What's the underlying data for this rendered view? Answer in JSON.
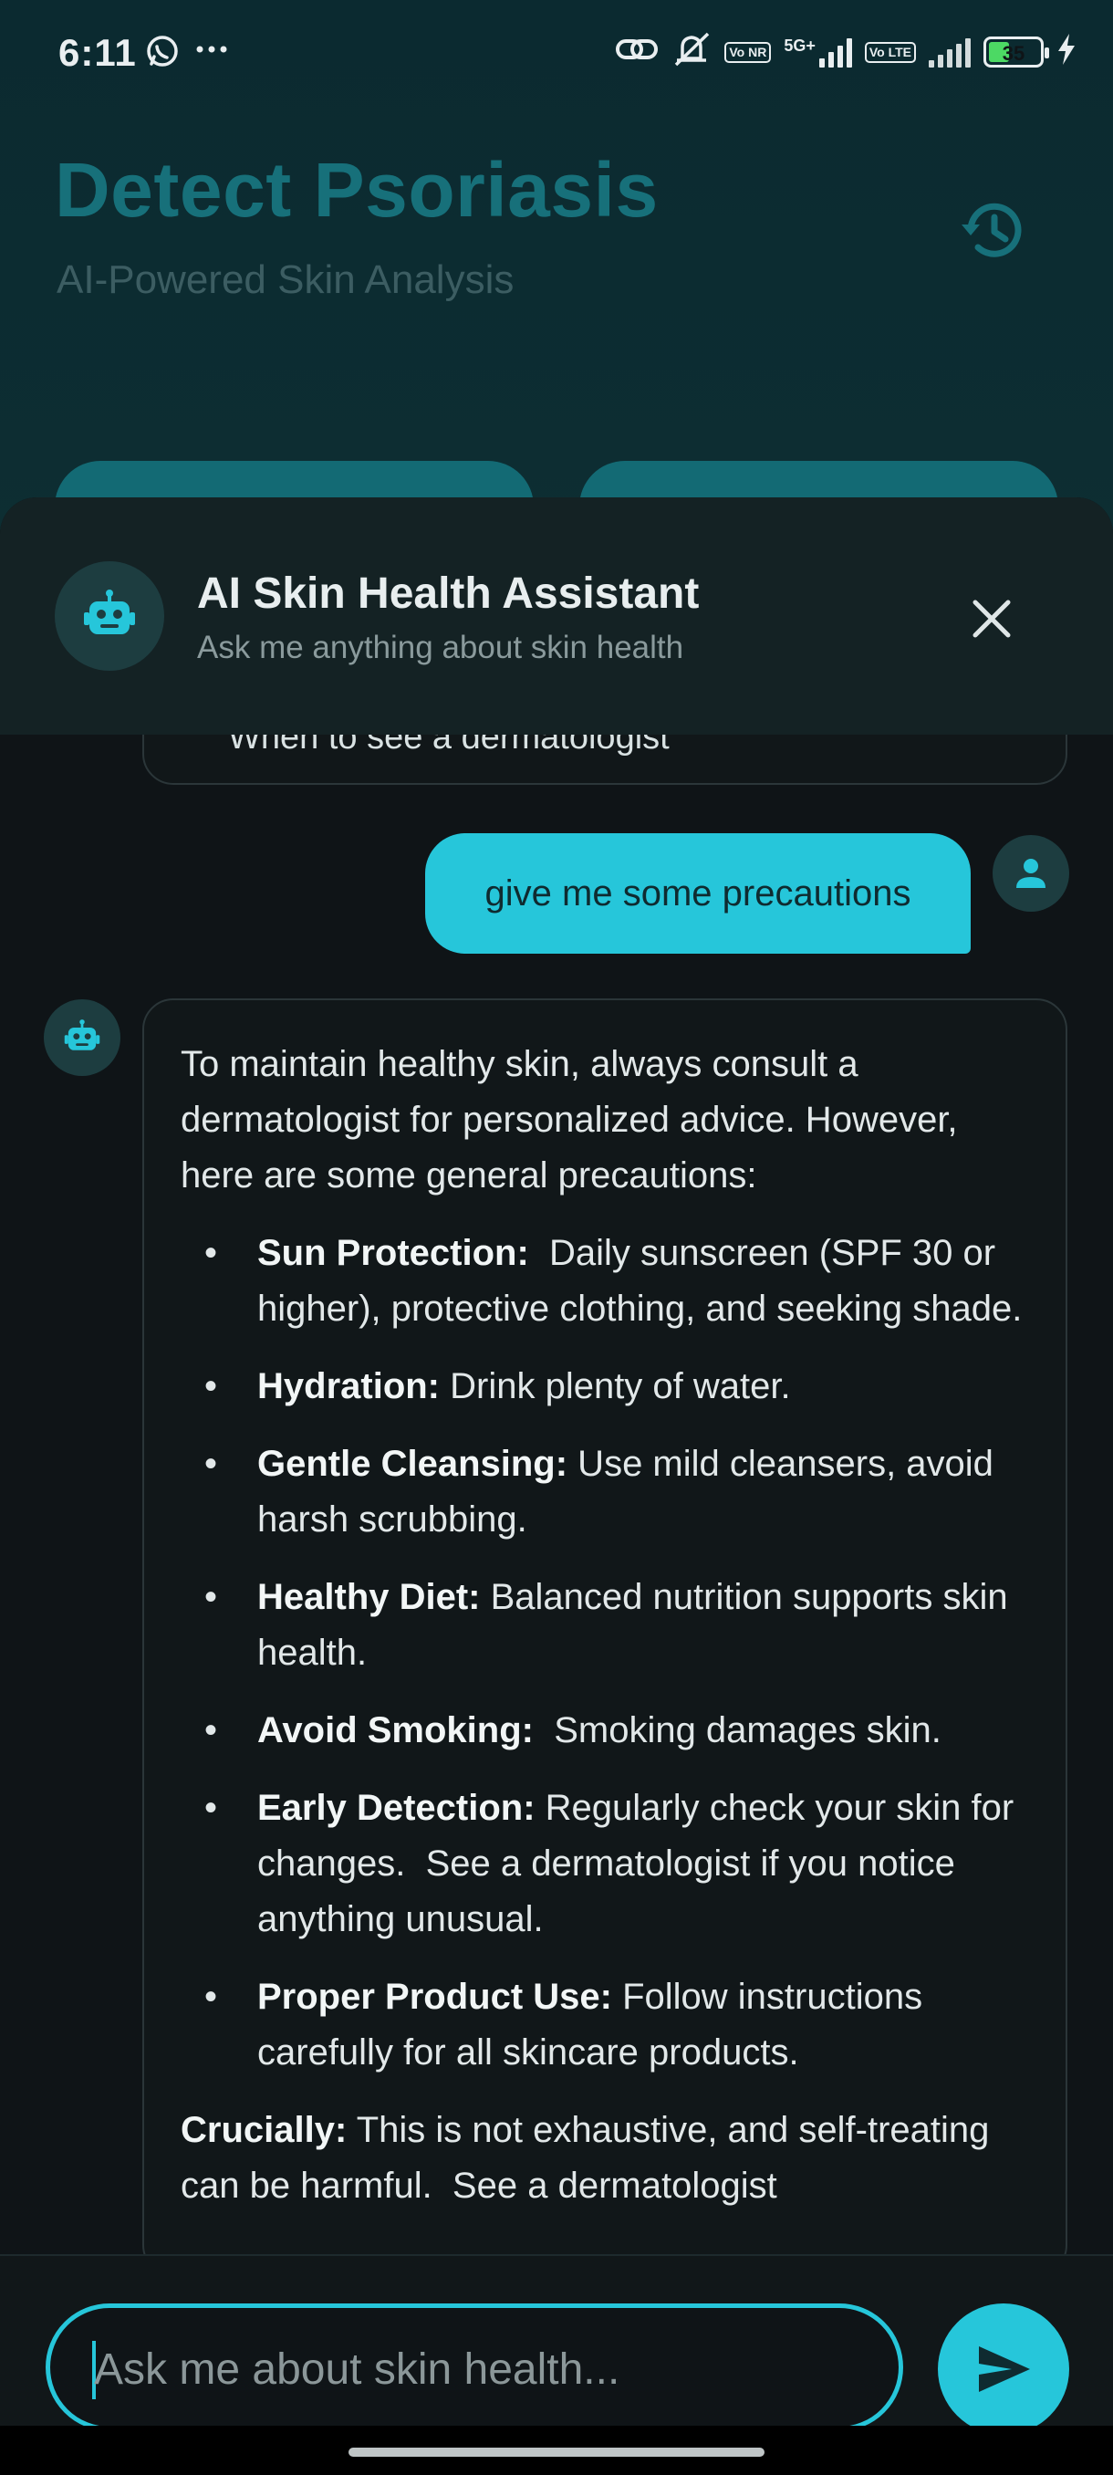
{
  "status_bar": {
    "time": "6:11",
    "battery": "35",
    "icons": [
      "whatsapp-icon",
      "more-icon",
      "link-icon",
      "mute-icon",
      "vonr-icon",
      "signal-5g-icon",
      "volte-icon",
      "signal-icon",
      "battery-icon",
      "charging-icon"
    ],
    "net_5g": "5G+",
    "vo_tag": "Vo NR",
    "lte_tag": "Vo LTE"
  },
  "app": {
    "title": "Detect Psoriasis",
    "subtitle": "AI-Powered Skin Analysis"
  },
  "chat_sheet": {
    "title": "AI Skin Health Assistant",
    "subtitle": "Ask me anything about skin health"
  },
  "messages": {
    "previous_bot_tail": "When to see a dermatologist",
    "user_message": "give me some precautions",
    "bot_reply": {
      "intro": "To maintain healthy skin, always consult a dermatologist for personalized advice. However, here are some general precautions:",
      "items": [
        {
          "label": "Sun Protection:",
          "text": "  Daily sunscreen (SPF 30 or higher), protective clothing, and seeking shade."
        },
        {
          "label": "Hydration:",
          "text": " Drink plenty of water."
        },
        {
          "label": "Gentle Cleansing:",
          "text": " Use mild cleansers, avoid harsh scrubbing."
        },
        {
          "label": "Healthy Diet:",
          "text": " Balanced nutrition supports skin health."
        },
        {
          "label": "Avoid Smoking:",
          "text": "  Smoking damages skin."
        },
        {
          "label": "Early Detection:",
          "text": " Regularly check your skin for changes.  See a dermatologist if you notice anything unusual."
        },
        {
          "label": "Proper Product Use:",
          "text": " Follow instructions carefully for all skincare products."
        }
      ],
      "crucial_label": "Crucially:",
      "crucial_text": " This is not exhaustive, and self-treating can be harmful.  See a dermatologist"
    }
  },
  "input": {
    "placeholder": "Ask me about skin health..."
  },
  "colors": {
    "accent": "#26c6da",
    "background": "#0f1417",
    "header_bg": "#142224",
    "title_dim": "#17707a"
  }
}
